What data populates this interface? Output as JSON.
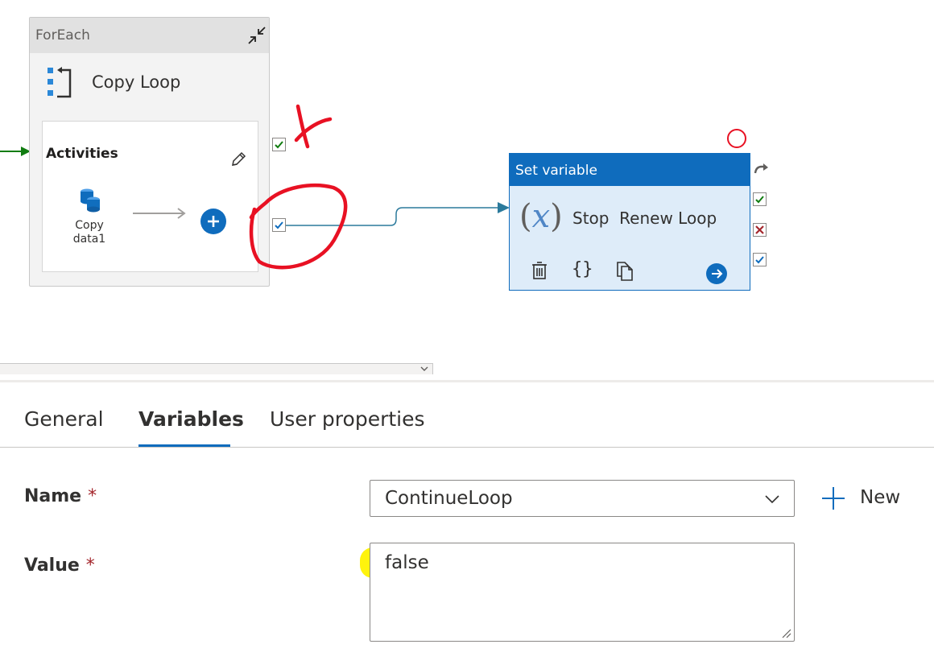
{
  "pipeline_canvas": {
    "foreach": {
      "title": "ForEach",
      "name": "Copy Loop",
      "activities_label": "Activities",
      "inner_activity": {
        "name_line1": "Copy",
        "name_line2": "data1"
      }
    },
    "set_variable": {
      "title": "Set variable",
      "name": "Stop  Renew Loop",
      "fx_open": "(",
      "fx_var": "x",
      "fx_close": ")",
      "braces": "{}"
    },
    "colors": {
      "accent": "#0f6cbd",
      "success": "#107c10",
      "fail": "#a4262c",
      "annotation_red": "#e81123",
      "highlight_yellow": "#fff200"
    }
  },
  "properties_panel": {
    "tabs": [
      {
        "label": "General",
        "active": false
      },
      {
        "label": "Variables",
        "active": true
      },
      {
        "label": "User properties",
        "active": false
      }
    ],
    "name_field": {
      "label": "Name",
      "required_mark": "*",
      "value": "ContinueLoop"
    },
    "new_button": {
      "label": "New"
    },
    "value_field": {
      "label": "Value",
      "required_mark": "*",
      "value": "false"
    }
  }
}
